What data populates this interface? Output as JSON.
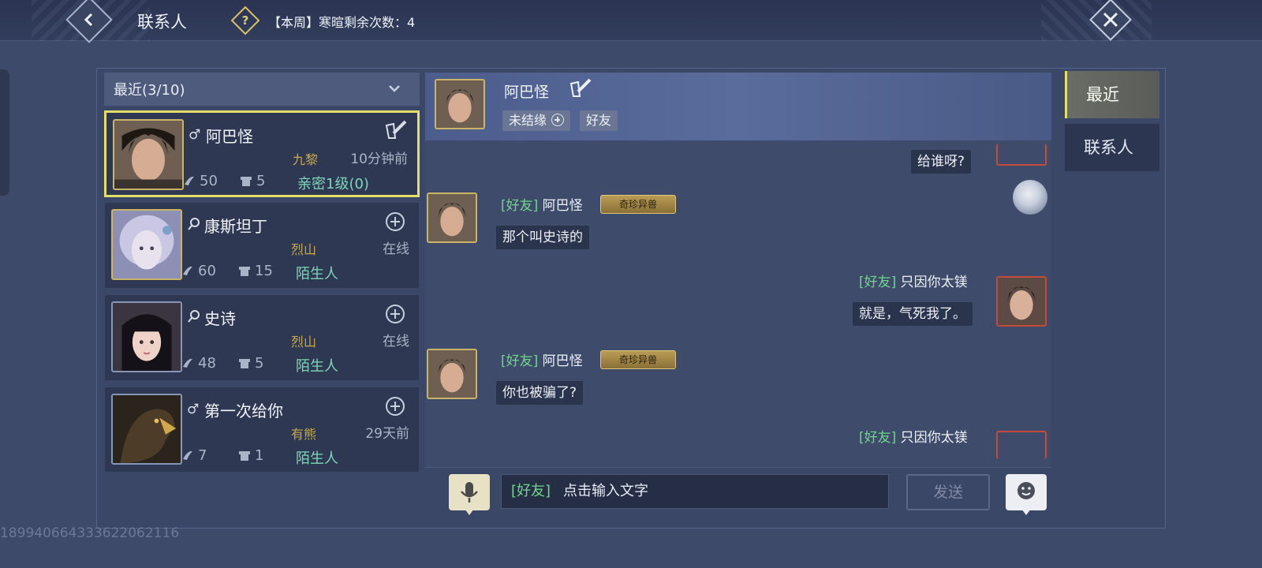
{
  "header": {
    "title": "联系人",
    "help_symbol": "?",
    "week_note": "【本周】寒暄剩余次数：4"
  },
  "filter": {
    "label": "最近(3/10)"
  },
  "contacts": [
    {
      "sex": "♂",
      "name": "阿巴怪",
      "school": "九黎",
      "status": "10分钟前",
      "stat1": "50",
      "stat2": "5",
      "relation": "亲密1级(0)"
    },
    {
      "sex": "♀",
      "name": "康斯坦丁",
      "school": "烈山",
      "status": "在线",
      "stat1": "60",
      "stat2": "15",
      "relation": "陌生人"
    },
    {
      "sex": "♀",
      "name": "史诗",
      "school": "烈山",
      "status": "在线",
      "stat1": "48",
      "stat2": "5",
      "relation": "陌生人"
    },
    {
      "sex": "♂",
      "name": "第一次给你",
      "school": "有熊",
      "status": "29天前",
      "stat1": "7",
      "stat2": "1",
      "relation": "陌生人"
    }
  ],
  "chat": {
    "target_name": "阿巴怪",
    "tag_unbound": "未结缘",
    "tag_friend": "好友",
    "messages": [
      {
        "side": "right",
        "text": "给谁呀?"
      },
      {
        "side": "left",
        "tag": "[好友]",
        "sender": "阿巴怪",
        "badge": "奇珍异兽",
        "text": "那个叫史诗的"
      },
      {
        "side": "right",
        "tag": "[好友]",
        "sender": "只因你太镁",
        "text": "就是，气死我了。"
      },
      {
        "side": "left",
        "tag": "[好友]",
        "sender": "阿巴怪",
        "badge": "奇珍异兽",
        "text": "你也被骗了?"
      },
      {
        "side": "right",
        "tag": "[好友]",
        "sender": "只因你太镁"
      }
    ]
  },
  "input": {
    "channel": "[好友]",
    "placeholder": "点击输入文字",
    "send_label": "发送"
  },
  "right_tabs": [
    {
      "label": "最近",
      "active": true
    },
    {
      "label": "联系人",
      "active": false
    }
  ],
  "watermark": "18994066433362206211​6",
  "colors": {
    "friend_tag": "#6fd68c",
    "selected_border": "#e6de6a",
    "school": "#c9a847",
    "relation": "#7fd6b8"
  }
}
